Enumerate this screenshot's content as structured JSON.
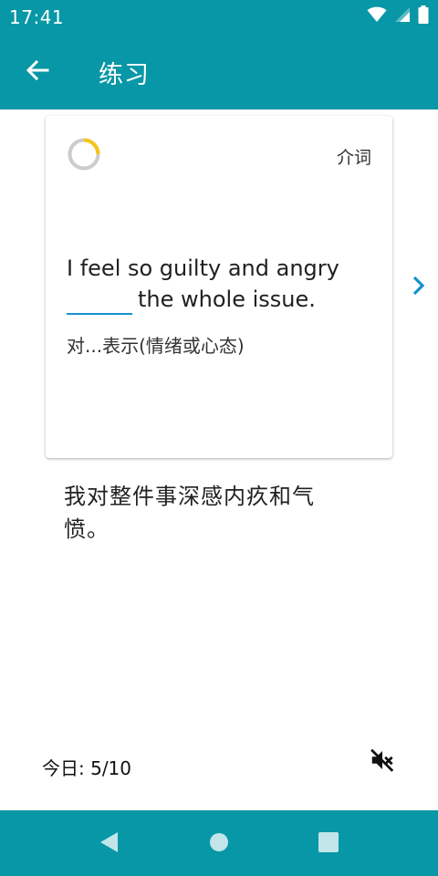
{
  "status_bar": {
    "time": "17:41",
    "icons": [
      "wifi-icon",
      "cellular-signal-icon",
      "battery-icon"
    ]
  },
  "app_bar": {
    "back_icon": "arrow-left-icon",
    "title": "练习"
  },
  "card": {
    "part_of_speech": "介词",
    "sentence_before_blank": "I feel so guilty and angry",
    "sentence_after_blank": "the whole issue.",
    "hint": "对...表示(情绪或心态)",
    "progress_fraction": 0.25
  },
  "translation": "我对整件事深感内疚和气愤。",
  "footer": {
    "today_label": "今日: 5/10",
    "mute_icon": "volume-off-icon"
  },
  "nav_bar": {
    "items": [
      "back-triangle-icon",
      "home-circle-icon",
      "recents-square-icon"
    ]
  },
  "colors": {
    "primary": "#0897a6",
    "accent": "#1591cf",
    "progress_arc": "#f5c518",
    "progress_track": "#cccccc"
  }
}
